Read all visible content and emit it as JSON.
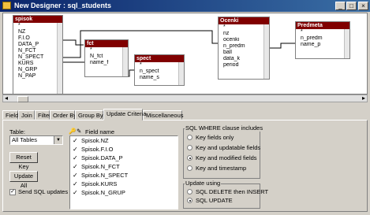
{
  "window": {
    "title": "New Designer : sql_students",
    "min": "_",
    "max": "□",
    "close": "×"
  },
  "tables": {
    "spisok": {
      "name": "spisok",
      "fields": [
        "*",
        "NZ",
        "F.I.O",
        "DATA_P",
        "N_FCT",
        "N_SPECT",
        "KURS",
        "N_GRP",
        "N_PAP"
      ]
    },
    "fct": {
      "name": "fct",
      "fields": [
        "*",
        "N_fct",
        "name_f"
      ]
    },
    "spect": {
      "name": "spect",
      "fields": [
        "*",
        "n_spect",
        "name_s"
      ]
    },
    "ocenki": {
      "name": "Ocenki",
      "fields": [
        "*",
        "nz",
        "ocenki",
        "n_predm",
        "ball",
        "data_k",
        "period"
      ]
    },
    "predmeta": {
      "name": "Predmeta",
      "fields": [
        "*",
        "n_predm",
        "name_p"
      ]
    }
  },
  "tabs": [
    "Fields",
    "Join",
    "Filter",
    "Order By",
    "Group By",
    "Update Criteria",
    "Miscellaneous"
  ],
  "active_tab": "Update Criteria",
  "update_criteria": {
    "table_label": "Table:",
    "table_value": "All Tables",
    "reset_key": "Reset Key",
    "update_all": "Update All",
    "send_sql_updates": "Send SQL updates",
    "field_name_header": "Field name",
    "fields": [
      "Spisok.NZ",
      "Spisok.F.I.O",
      "Spisok.DATA_P",
      "Spisok.N_FCT",
      "Spisok.N_SPECT",
      "Spisok.KURS",
      "Spisok.N_GRUP"
    ],
    "where_group_label": "SQL WHERE clause includes",
    "where_options": [
      "Key fields only",
      "Key and updatable fields",
      "Key and modified fields",
      "Key and timestamp"
    ],
    "where_selected": 2,
    "update_using_label": "Update using",
    "update_options": [
      "SQL DELETE then INSERT",
      "SQL UPDATE"
    ],
    "update_selected": 1
  }
}
